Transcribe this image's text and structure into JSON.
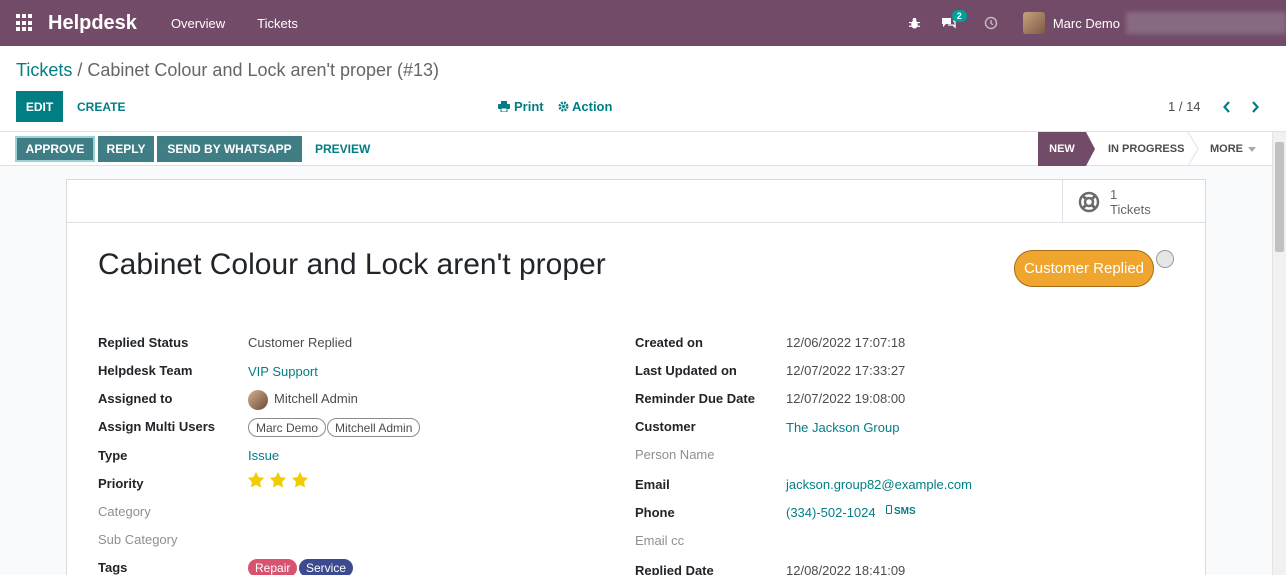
{
  "nav": {
    "brand": "Helpdesk",
    "items": [
      "Overview",
      "Tickets"
    ],
    "messages_count": "2",
    "user_name": "Marc Demo"
  },
  "control_panel": {
    "breadcrumb_parent": "Tickets",
    "breadcrumb_sep": " / ",
    "breadcrumb_current": "Cabinet Colour and Lock aren't proper (#13)",
    "edit_label": "EDIT",
    "create_label": "CREATE",
    "print_label": "Print",
    "action_label": "Action",
    "pager": "1 / 14"
  },
  "statusbar": {
    "buttons": [
      "APPROVE",
      "REPLY",
      "SEND BY WHATSAPP",
      "PREVIEW"
    ],
    "stages": [
      "NEW",
      "IN PROGRESS",
      "MORE"
    ],
    "active_stage": "NEW"
  },
  "smart_button": {
    "count": "1",
    "label": "Tickets"
  },
  "ticket": {
    "title": "Cabinet Colour and Lock aren't proper",
    "replied_badge": "Customer Replied",
    "left": {
      "replied_status": {
        "label": "Replied Status",
        "value": "Customer Replied"
      },
      "helpdesk_team": {
        "label": "Helpdesk Team",
        "value": "VIP Support"
      },
      "assigned_to": {
        "label": "Assigned to",
        "value": "Mitchell Admin"
      },
      "multi_users": {
        "label": "Assign Multi Users",
        "values": [
          "Marc Demo",
          "Mitchell Admin"
        ]
      },
      "type": {
        "label": "Type",
        "value": "Issue"
      },
      "priority": {
        "label": "Priority",
        "stars": 3,
        "max": 3
      },
      "category": {
        "label": "Category"
      },
      "sub_category": {
        "label": "Sub Category"
      },
      "tags": {
        "label": "Tags",
        "values": [
          "Repair",
          "Service"
        ]
      }
    },
    "right": {
      "created_on": {
        "label": "Created on",
        "value": "12/06/2022 17:07:18"
      },
      "last_updated": {
        "label": "Last Updated on",
        "value": "12/07/2022 17:33:27"
      },
      "reminder": {
        "label": "Reminder Due Date",
        "value": "12/07/2022 19:08:00"
      },
      "customer": {
        "label": "Customer",
        "value": "The Jackson Group"
      },
      "person_name": {
        "label": "Person Name"
      },
      "email": {
        "label": "Email",
        "value": "jackson.group82@example.com"
      },
      "phone": {
        "label": "Phone",
        "value": "(334)-502-1024",
        "sms": "SMS"
      },
      "email_cc": {
        "label": "Email cc"
      },
      "replied_date": {
        "label": "Replied Date",
        "value": "12/08/2022 18:41:09"
      }
    }
  },
  "colors": {
    "nav_bg": "#714b67",
    "primary": "#017e84",
    "button_bg": "#3f7e84",
    "badge_orange": "#f0a52e",
    "tag_repair": "#d9536f",
    "tag_service": "#3c4a8f",
    "star": "#f3cc00"
  }
}
